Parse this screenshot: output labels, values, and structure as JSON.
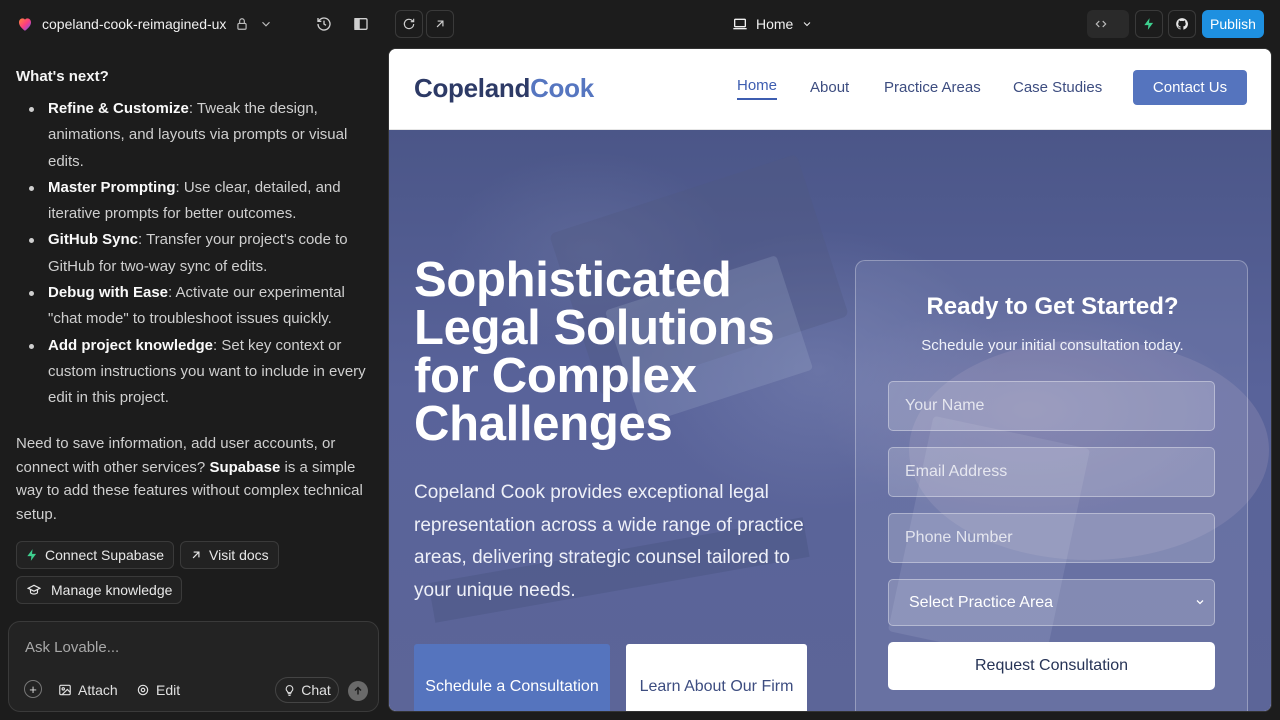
{
  "app": {
    "project_name": "copeland-cook-reimagined-ux",
    "route": "Home",
    "publish_label": "Publish"
  },
  "chat": {
    "whats_next": "What's next?",
    "bullets": [
      {
        "title": "Refine & Customize",
        "text": ": Tweak the design, animations, and layouts via prompts or visual edits."
      },
      {
        "title": "Master Prompting",
        "text": ": Use clear, detailed, and iterative prompts for better outcomes."
      },
      {
        "title": "GitHub Sync",
        "text": ": Transfer your project's code to GitHub for two-way sync of edits."
      },
      {
        "title": "Debug with Ease",
        "text": ": Activate our experimental \"chat mode\" to troubleshoot issues quickly."
      },
      {
        "title": "Add project knowledge",
        "text": ": Set key context or custom instructions you want to include in every edit in this project."
      }
    ],
    "supabase_pre": "Need to save information, add user accounts, or connect with other services? ",
    "supabase_name": "Supabase",
    "supabase_post": " is a simple way to add these features without complex technical setup.",
    "connect_supabase": "Connect Supabase",
    "visit_docs": "Visit docs",
    "manage_knowledge": "Manage knowledge",
    "composer_placeholder": "Ask Lovable...",
    "attach": "Attach",
    "edit": "Edit",
    "chat_mode": "Chat"
  },
  "site": {
    "logo_part1": "Copeland",
    "logo_part2": "Cook",
    "nav": [
      "Home",
      "About",
      "Practice Areas",
      "Case Studies"
    ],
    "contact": "Contact Us",
    "hero_title": "Sophisticated Legal Solutions for Complex Challenges",
    "hero_sub": "Copeland Cook provides exceptional legal representation across a wide range of practice areas, delivering strategic counsel tailored to your unique needs.",
    "cta_primary": "Schedule a Consultation",
    "cta_secondary": "Learn About Our Firm",
    "form": {
      "title": "Ready to Get Started?",
      "subtitle": "Schedule your initial consultation today.",
      "name_placeholder": "Your Name",
      "email_placeholder": "Email Address",
      "phone_placeholder": "Phone Number",
      "select_value": "Select Practice Area",
      "submit": "Request Consultation"
    }
  },
  "colors": {
    "publish": "#1e90e0",
    "brand_dark": "#2d3a66",
    "brand_accent": "#5574be",
    "supabase_green": "#3ecf8e"
  }
}
